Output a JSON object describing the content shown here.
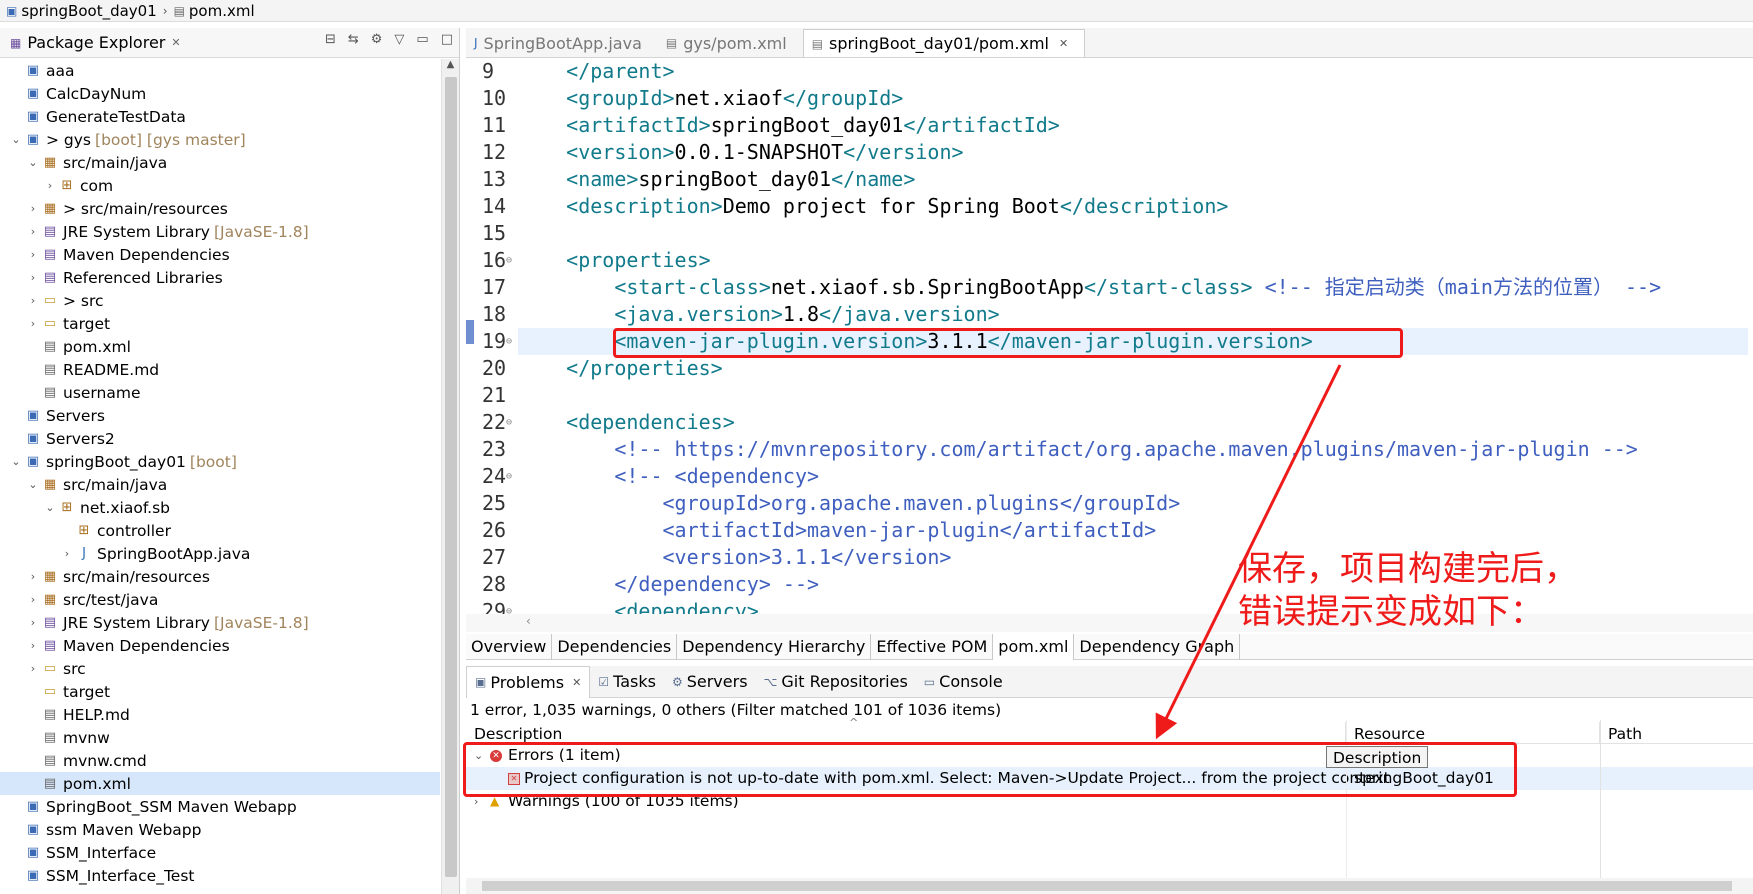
{
  "breadcrumb": {
    "project": "springBoot_day01",
    "file": "pom.xml"
  },
  "explorer": {
    "title": "Package Explorer",
    "tree": [
      {
        "indent": 0,
        "arrow": "",
        "icon": "project",
        "label": "aaa",
        "deco": ""
      },
      {
        "indent": 0,
        "arrow": "",
        "icon": "project",
        "label": "CalcDayNum",
        "deco": ""
      },
      {
        "indent": 0,
        "arrow": "",
        "icon": "project",
        "label": "GenerateTestData",
        "deco": ""
      },
      {
        "indent": 0,
        "arrow": "open",
        "icon": "project",
        "label": "> gys",
        "deco": "[boot] [gys master]"
      },
      {
        "indent": 1,
        "arrow": "open",
        "icon": "srcfolder",
        "label": "src/main/java",
        "deco": ""
      },
      {
        "indent": 2,
        "arrow": "closed",
        "icon": "package",
        "label": "com",
        "deco": ""
      },
      {
        "indent": 1,
        "arrow": "closed",
        "icon": "srcfolder",
        "label": "> src/main/resources",
        "deco": ""
      },
      {
        "indent": 1,
        "arrow": "closed",
        "icon": "library",
        "label": "JRE System Library",
        "deco": "[JavaSE-1.8]"
      },
      {
        "indent": 1,
        "arrow": "closed",
        "icon": "library",
        "label": "Maven Dependencies",
        "deco": ""
      },
      {
        "indent": 1,
        "arrow": "closed",
        "icon": "library",
        "label": "Referenced Libraries",
        "deco": ""
      },
      {
        "indent": 1,
        "arrow": "closed",
        "icon": "folder",
        "label": "> src",
        "deco": ""
      },
      {
        "indent": 1,
        "arrow": "closed",
        "icon": "folder",
        "label": "target",
        "deco": ""
      },
      {
        "indent": 1,
        "arrow": "",
        "icon": "file",
        "label": "pom.xml",
        "deco": ""
      },
      {
        "indent": 1,
        "arrow": "",
        "icon": "file",
        "label": "README.md",
        "deco": ""
      },
      {
        "indent": 1,
        "arrow": "",
        "icon": "file",
        "label": "username",
        "deco": ""
      },
      {
        "indent": 0,
        "arrow": "",
        "icon": "project",
        "label": "Servers",
        "deco": ""
      },
      {
        "indent": 0,
        "arrow": "",
        "icon": "project",
        "label": "Servers2",
        "deco": ""
      },
      {
        "indent": 0,
        "arrow": "open",
        "icon": "project",
        "label": "springBoot_day01",
        "deco": "[boot]"
      },
      {
        "indent": 1,
        "arrow": "open",
        "icon": "srcfolder",
        "label": "src/main/java",
        "deco": ""
      },
      {
        "indent": 2,
        "arrow": "open",
        "icon": "package",
        "label": "net.xiaof.sb",
        "deco": ""
      },
      {
        "indent": 3,
        "arrow": "",
        "icon": "package",
        "label": "controller",
        "deco": ""
      },
      {
        "indent": 3,
        "arrow": "closed",
        "icon": "java",
        "label": "SpringBootApp.java",
        "deco": ""
      },
      {
        "indent": 1,
        "arrow": "closed",
        "icon": "srcfolder",
        "label": "src/main/resources",
        "deco": ""
      },
      {
        "indent": 1,
        "arrow": "closed",
        "icon": "srcfolder",
        "label": "src/test/java",
        "deco": ""
      },
      {
        "indent": 1,
        "arrow": "closed",
        "icon": "library",
        "label": "JRE System Library",
        "deco": "[JavaSE-1.8]"
      },
      {
        "indent": 1,
        "arrow": "closed",
        "icon": "library",
        "label": "Maven Dependencies",
        "deco": ""
      },
      {
        "indent": 1,
        "arrow": "closed",
        "icon": "folder",
        "label": "src",
        "deco": ""
      },
      {
        "indent": 1,
        "arrow": "",
        "icon": "folder",
        "label": "target",
        "deco": ""
      },
      {
        "indent": 1,
        "arrow": "",
        "icon": "file",
        "label": "HELP.md",
        "deco": ""
      },
      {
        "indent": 1,
        "arrow": "",
        "icon": "file",
        "label": "mvnw",
        "deco": ""
      },
      {
        "indent": 1,
        "arrow": "",
        "icon": "file",
        "label": "mvnw.cmd",
        "deco": ""
      },
      {
        "indent": 1,
        "arrow": "",
        "icon": "file",
        "label": "pom.xml",
        "deco": "",
        "selected": true
      },
      {
        "indent": 0,
        "arrow": "",
        "icon": "project",
        "label": "SpringBoot_SSM Maven Webapp",
        "deco": ""
      },
      {
        "indent": 0,
        "arrow": "",
        "icon": "project",
        "label": "ssm Maven Webapp",
        "deco": ""
      },
      {
        "indent": 0,
        "arrow": "",
        "icon": "project",
        "label": "SSM_Interface",
        "deco": ""
      },
      {
        "indent": 0,
        "arrow": "",
        "icon": "project",
        "label": "SSM_Interface_Test",
        "deco": ""
      }
    ]
  },
  "editor": {
    "tabs": [
      {
        "label": "SpringBootApp.java",
        "active": false
      },
      {
        "label": "gys/pom.xml",
        "active": false
      },
      {
        "label": "springBoot_day01/pom.xml",
        "active": true
      }
    ],
    "lines": [
      {
        "num": "9",
        "fold": "",
        "hl": false,
        "parts": [
          [
            "tag",
            "    </parent>"
          ]
        ]
      },
      {
        "num": "10",
        "fold": "",
        "hl": false,
        "parts": [
          [
            "tag",
            "    <groupId>"
          ],
          [
            "txt",
            "net.xiaof"
          ],
          [
            "tag",
            "</groupId>"
          ]
        ]
      },
      {
        "num": "11",
        "fold": "",
        "hl": false,
        "parts": [
          [
            "tag",
            "    <artifactId>"
          ],
          [
            "txt",
            "springBoot_day01"
          ],
          [
            "tag",
            "</artifactId>"
          ]
        ]
      },
      {
        "num": "12",
        "fold": "",
        "hl": false,
        "parts": [
          [
            "tag",
            "    <version>"
          ],
          [
            "txt",
            "0.0.1-SNAPSHOT"
          ],
          [
            "tag",
            "</version>"
          ]
        ]
      },
      {
        "num": "13",
        "fold": "",
        "hl": false,
        "parts": [
          [
            "tag",
            "    <name>"
          ],
          [
            "txt",
            "springBoot_day01"
          ],
          [
            "tag",
            "</name>"
          ]
        ]
      },
      {
        "num": "14",
        "fold": "",
        "hl": false,
        "parts": [
          [
            "tag",
            "    <description>"
          ],
          [
            "txt",
            "Demo project for Spring Boot"
          ],
          [
            "tag",
            "</description>"
          ]
        ]
      },
      {
        "num": "15",
        "fold": "",
        "hl": false,
        "parts": [
          [
            "txt",
            ""
          ]
        ]
      },
      {
        "num": "16",
        "fold": "⊖",
        "hl": false,
        "parts": [
          [
            "tag",
            "    <properties>"
          ]
        ]
      },
      {
        "num": "17",
        "fold": "",
        "hl": false,
        "parts": [
          [
            "tag",
            "        <start-class>"
          ],
          [
            "txt",
            "net.xiaof.sb.SpringBootApp"
          ],
          [
            "tag",
            "</start-class>"
          ],
          [
            "com",
            " <!-- 指定启动类（main方法的位置） -->"
          ]
        ]
      },
      {
        "num": "18",
        "fold": "",
        "hl": false,
        "parts": [
          [
            "tag",
            "        <java.version>"
          ],
          [
            "txt",
            "1.8"
          ],
          [
            "tag",
            "</java.version>"
          ]
        ]
      },
      {
        "num": "19",
        "fold": "⊖",
        "hl": true,
        "parts": [
          [
            "tag",
            "        <maven-jar-plugin.version>"
          ],
          [
            "txt",
            "3.1.1"
          ],
          [
            "tag",
            "</maven-jar-plugin.version>"
          ]
        ]
      },
      {
        "num": "20",
        "fold": "",
        "hl": false,
        "parts": [
          [
            "tag",
            "    </properties>"
          ]
        ]
      },
      {
        "num": "21",
        "fold": "",
        "hl": false,
        "parts": [
          [
            "txt",
            ""
          ]
        ]
      },
      {
        "num": "22",
        "fold": "⊖",
        "hl": false,
        "parts": [
          [
            "tag",
            "    <dependencies>"
          ]
        ]
      },
      {
        "num": "23",
        "fold": "",
        "hl": false,
        "parts": [
          [
            "com",
            "        <!-- https://mvnrepository.com/artifact/org.apache.maven.plugins/maven-jar-plugin -->"
          ]
        ]
      },
      {
        "num": "24",
        "fold": "⊖",
        "hl": false,
        "parts": [
          [
            "com",
            "        <!-- <dependency>"
          ]
        ]
      },
      {
        "num": "25",
        "fold": "",
        "hl": false,
        "parts": [
          [
            "com",
            "            <groupId>org.apache.maven.plugins</groupId>"
          ]
        ]
      },
      {
        "num": "26",
        "fold": "",
        "hl": false,
        "parts": [
          [
            "com",
            "            <artifactId>maven-jar-plugin</artifactId>"
          ]
        ]
      },
      {
        "num": "27",
        "fold": "",
        "hl": false,
        "parts": [
          [
            "com",
            "            <version>3.1.1</version>"
          ]
        ]
      },
      {
        "num": "28",
        "fold": "",
        "hl": false,
        "parts": [
          [
            "com",
            "        </dependency> -->"
          ]
        ]
      },
      {
        "num": "29",
        "fold": "⊖",
        "hl": false,
        "parts": [
          [
            "tag",
            "        <dependency>"
          ]
        ]
      }
    ]
  },
  "pom_tabs": [
    {
      "label": "Overview",
      "active": false
    },
    {
      "label": "Dependencies",
      "active": false
    },
    {
      "label": "Dependency Hierarchy",
      "active": false
    },
    {
      "label": "Effective POM",
      "active": false
    },
    {
      "label": "pom.xml",
      "active": true
    },
    {
      "label": "Dependency Graph",
      "active": false
    }
  ],
  "problems": {
    "tabs": [
      {
        "label": "Problems",
        "icon": "problems-icon",
        "active": true
      },
      {
        "label": "Tasks",
        "icon": "tasks-icon",
        "active": false
      },
      {
        "label": "Servers",
        "icon": "servers-icon",
        "active": false
      },
      {
        "label": "Git Repositories",
        "icon": "git-icon",
        "active": false
      },
      {
        "label": "Console",
        "icon": "console-icon",
        "active": false
      }
    ],
    "summary": "1 error, 1,035 warnings, 0 others (Filter matched 101 of 1036 items)",
    "columns": {
      "description": "Description",
      "resource": "Resource",
      "path": "Path"
    },
    "errors_group": "Errors (1 item)",
    "error_item": {
      "description": "Project configuration is not up-to-date with pom.xml. Select: Maven->Update Project... from the project context",
      "resource": "springBoot_day01"
    },
    "warnings_group": "Warnings (100 of 1035 items)",
    "tooltip": "Description"
  },
  "annotation": {
    "line1": "保存，项目构建完后，",
    "line2": "错误提示变成如下：",
    "color": "#ef1a1a"
  }
}
